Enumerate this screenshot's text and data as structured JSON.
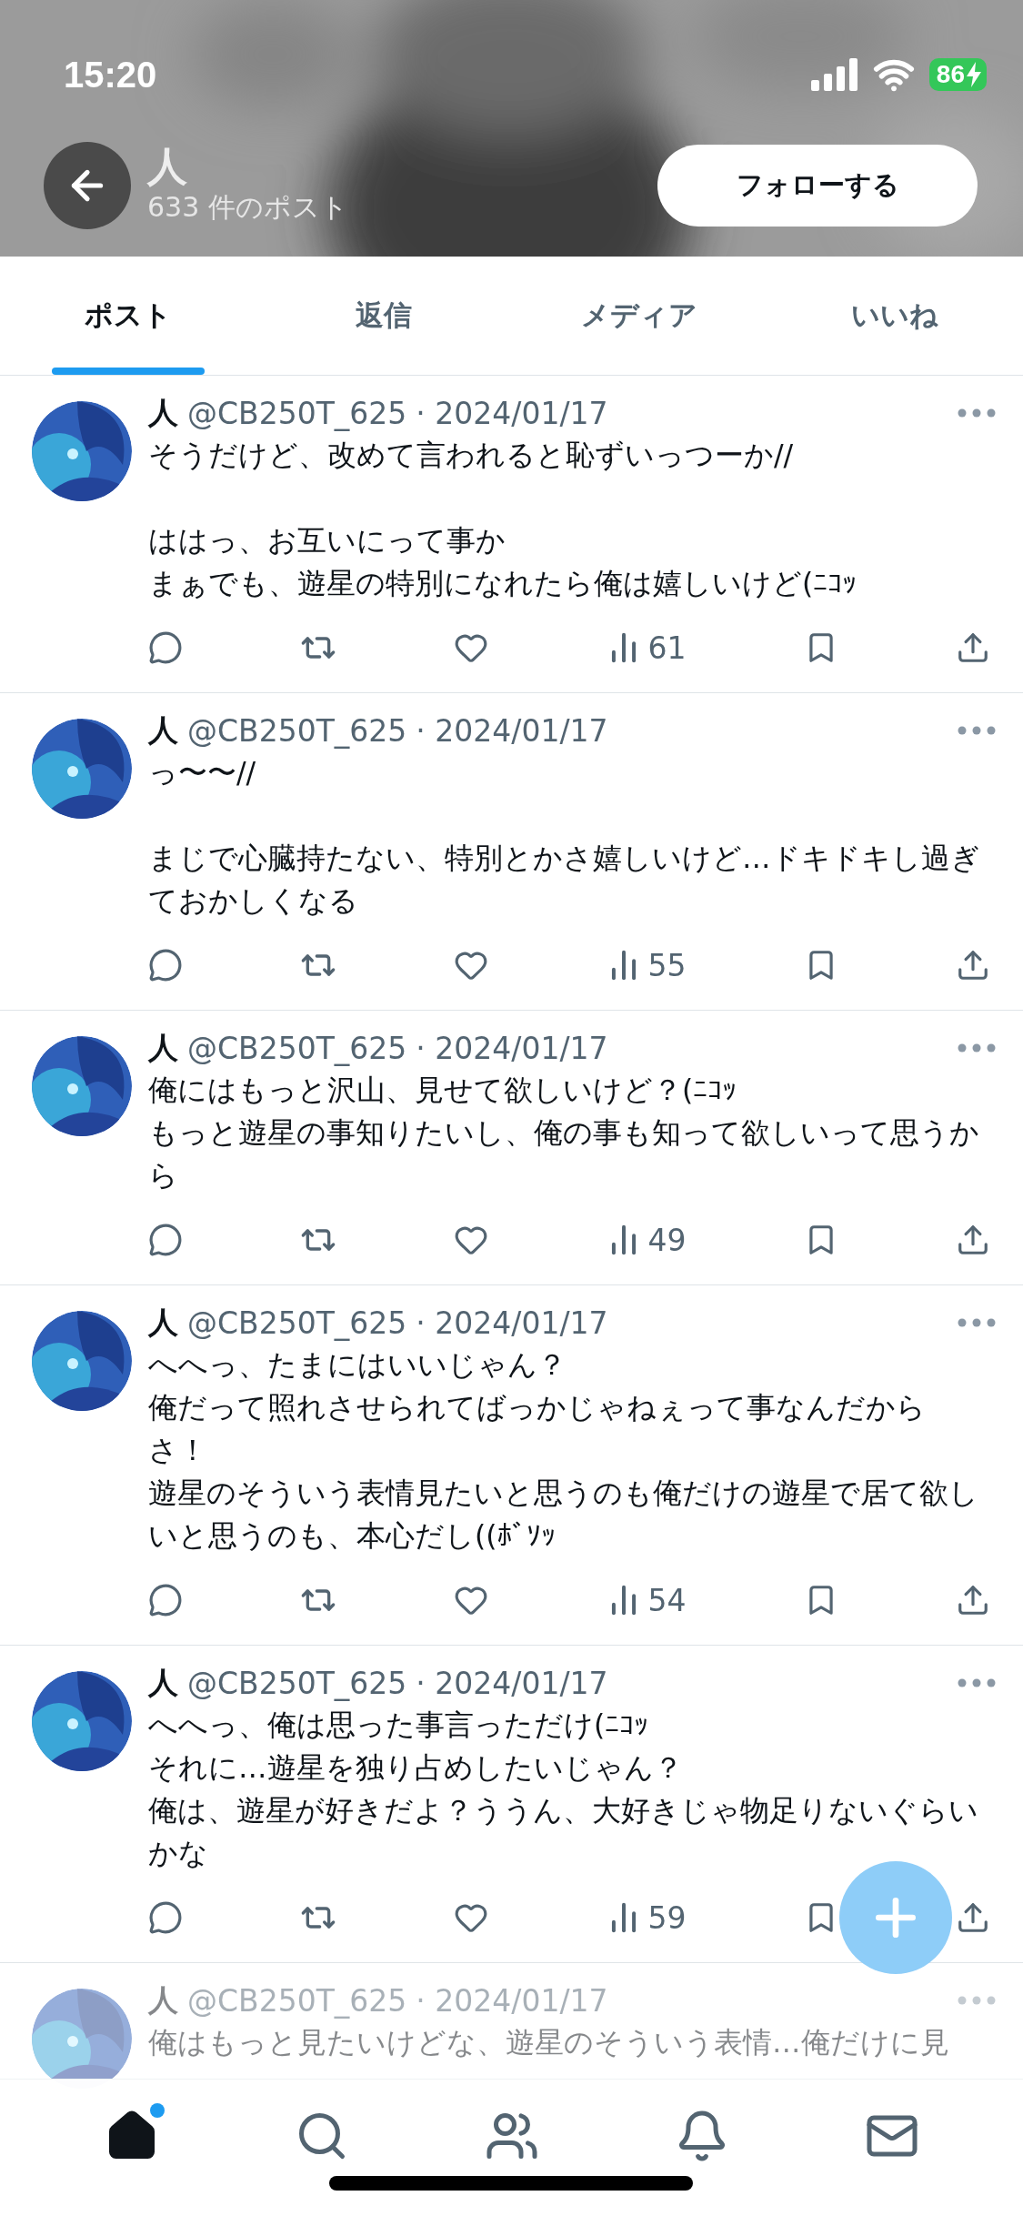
{
  "status_bar": {
    "time": "15:20",
    "battery": "86",
    "charging": true
  },
  "profile_header": {
    "name": "人",
    "post_count": "633 件のポスト",
    "follow_button": "フォローする"
  },
  "tabs": [
    {
      "label": "ポスト",
      "selected": true
    },
    {
      "label": "返信",
      "selected": false
    },
    {
      "label": "メディア",
      "selected": false
    },
    {
      "label": "いいね",
      "selected": false
    }
  ],
  "posts": [
    {
      "name": "人",
      "handle": "@CB250T_625",
      "date": "· 2024/01/17",
      "paragraphs": [
        [
          "そうだけど、改めて言われると恥ずいっつーか//"
        ],
        [
          "ははっ、お互いにって事か",
          "まぁでも、遊星の特別になれたら俺は嬉しいけど(ﾆｺｯ"
        ]
      ],
      "views": "61",
      "faded": false
    },
    {
      "name": "人",
      "handle": "@CB250T_625",
      "date": "· 2024/01/17",
      "paragraphs": [
        [
          "っ〜〜//"
        ],
        [
          "まじで心臓持たない、特別とかさ嬉しいけど…ドキドキし過ぎておかしくなる"
        ]
      ],
      "views": "55",
      "faded": false
    },
    {
      "name": "人",
      "handle": "@CB250T_625",
      "date": "· 2024/01/17",
      "paragraphs": [
        [
          "俺にはもっと沢山、見せて欲しいけど？(ﾆｺｯ",
          "もっと遊星の事知りたいし、俺の事も知って欲しいって思うから"
        ]
      ],
      "views": "49",
      "faded": false
    },
    {
      "name": "人",
      "handle": "@CB250T_625",
      "date": "· 2024/01/17",
      "paragraphs": [
        [
          "へへっ、たまにはいいじゃん？",
          "俺だって照れさせられてばっかじゃねぇって事なんだからさ！",
          "遊星のそういう表情見たいと思うのも俺だけの遊星で居て欲しいと思うのも、本心だし((ﾎﾞｿｯ"
        ]
      ],
      "views": "54",
      "faded": false
    },
    {
      "name": "人",
      "handle": "@CB250T_625",
      "date": "· 2024/01/17",
      "paragraphs": [
        [
          "へへっ、俺は思った事言っただけ(ﾆｺｯ",
          "それに…遊星を独り占めしたいじゃん？",
          "俺は、遊星が好きだよ？ううん、大好きじゃ物足りないぐらいかな"
        ]
      ],
      "views": "59",
      "faded": false
    },
    {
      "name": "人",
      "handle": "@CB250T_625",
      "date": "· 2024/01/17",
      "paragraphs": [
        [
          "俺はもっと見たいけどな、遊星のそういう表情…俺だけに見"
        ]
      ],
      "faded": true
    }
  ],
  "bottom_nav": [
    {
      "kind": "home",
      "selected": true,
      "badge": true
    },
    {
      "kind": "search",
      "selected": false,
      "badge": false
    },
    {
      "kind": "people",
      "selected": false,
      "badge": false
    },
    {
      "kind": "bell",
      "selected": false,
      "badge": false
    },
    {
      "kind": "mail",
      "selected": false,
      "badge": false
    }
  ]
}
